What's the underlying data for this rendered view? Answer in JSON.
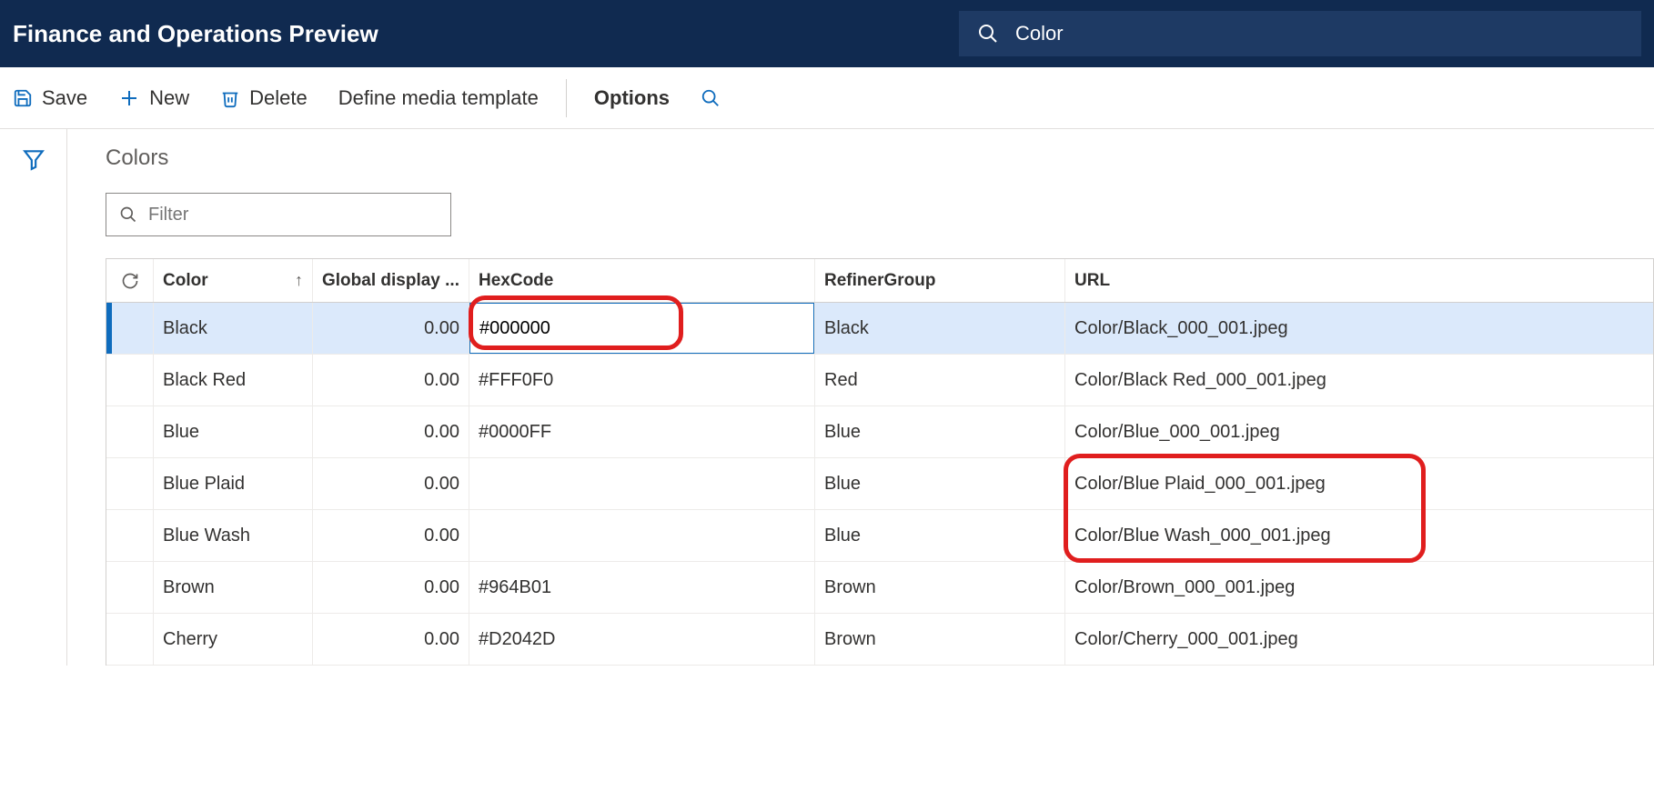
{
  "header": {
    "title": "Finance and Operations Preview",
    "search_text": "Color"
  },
  "toolbar": {
    "save": "Save",
    "new": "New",
    "delete": "Delete",
    "define_media": "Define media template",
    "options": "Options"
  },
  "section": {
    "title": "Colors",
    "filter_placeholder": "Filter"
  },
  "grid": {
    "columns": {
      "color": "Color",
      "global_display": "Global display ...",
      "hexcode": "HexCode",
      "refiner": "RefinerGroup",
      "url": "URL"
    },
    "rows": [
      {
        "color": "Black",
        "display": "0.00",
        "hex": "#000000",
        "refiner": "Black",
        "url": "Color/Black_000_001.jpeg",
        "selected": true
      },
      {
        "color": "Black Red",
        "display": "0.00",
        "hex": "#FFF0F0",
        "refiner": "Red",
        "url": "Color/Black Red_000_001.jpeg"
      },
      {
        "color": "Blue",
        "display": "0.00",
        "hex": "#0000FF",
        "refiner": "Blue",
        "url": "Color/Blue_000_001.jpeg"
      },
      {
        "color": "Blue Plaid",
        "display": "0.00",
        "hex": "",
        "refiner": "Blue",
        "url": "Color/Blue Plaid_000_001.jpeg"
      },
      {
        "color": "Blue Wash",
        "display": "0.00",
        "hex": "",
        "refiner": "Blue",
        "url": "Color/Blue Wash_000_001.jpeg"
      },
      {
        "color": "Brown",
        "display": "0.00",
        "hex": "#964B01",
        "refiner": "Brown",
        "url": "Color/Brown_000_001.jpeg"
      },
      {
        "color": "Cherry",
        "display": "0.00",
        "hex": "#D2042D",
        "refiner": "Brown",
        "url": "Color/Cherry_000_001.jpeg"
      }
    ]
  }
}
